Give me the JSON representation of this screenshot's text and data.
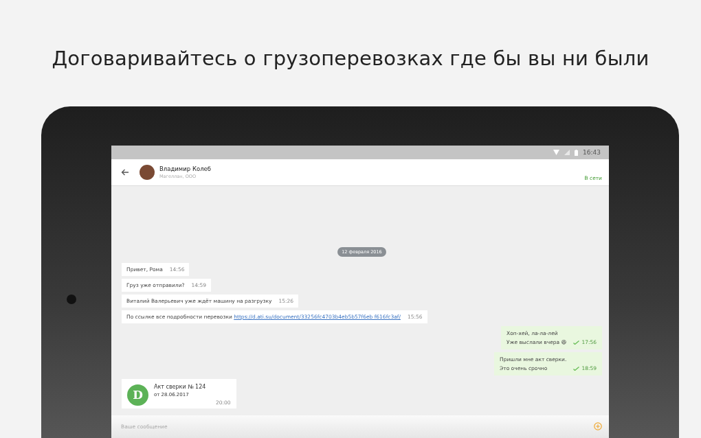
{
  "headline": "Договаривайтесь о грузоперевозках где бы вы ни были",
  "status_bar": {
    "time": "16:43"
  },
  "chat_header": {
    "name": "Владимир Колеб",
    "subtitle": "Магеллан, ООО",
    "presence": "В сети"
  },
  "date_divider": "12 февраля 2016",
  "messages": [
    {
      "kind": "in",
      "lines": [
        "Привет, Рома"
      ],
      "time": "14:56"
    },
    {
      "kind": "in",
      "lines": [
        "Груз уже отправили?"
      ],
      "time": "14:59"
    },
    {
      "kind": "in",
      "lines": [
        "Виталий Валерьевич уже ждёт машину на разгрузку"
      ],
      "time": "15:26"
    },
    {
      "kind": "in",
      "lines": [
        "По ссылке все подробности перевозки"
      ],
      "link": "https://d.ati.su/document/33256fc4703b4eb5b57f6eb f616fc3af/",
      "time": "15:56"
    },
    {
      "kind": "out",
      "lines": [
        "Хоп-хей, ла-ла-лей",
        "Уже выслали вчера 😆"
      ],
      "time": "17:56",
      "delivered": true
    },
    {
      "kind": "out",
      "lines": [
        "Пришли мне акт сверки.",
        "Это очень срочно"
      ],
      "time": "18:59",
      "delivered": true
    },
    {
      "kind": "doc",
      "icon_letter": "D",
      "lines": [
        "Акт сверки № 124",
        "от 28.06.2017"
      ],
      "time": "20:00"
    }
  ],
  "composer": {
    "placeholder": "Ваше сообщение"
  }
}
